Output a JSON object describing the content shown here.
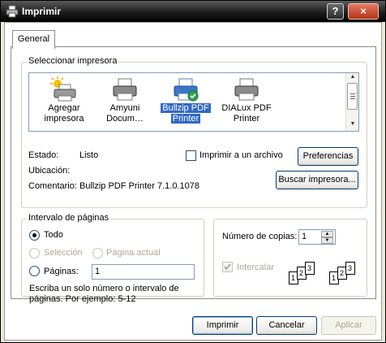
{
  "window": {
    "title": "Imprimir"
  },
  "tabs": [
    {
      "label": "General"
    }
  ],
  "printer_group": {
    "legend": "Seleccionar impresora",
    "printers": [
      {
        "line1": "Agregar",
        "line2": "impresora",
        "icon": "add-printer-icon"
      },
      {
        "line1": "Amyuni",
        "line2": "Docum…",
        "icon": "printer-icon"
      },
      {
        "line1": "Bullzip PDF",
        "line2": "Printer",
        "icon": "default-printer-icon",
        "selected": true
      },
      {
        "line1": "DIALux PDF",
        "line2": "Printer",
        "icon": "printer-icon"
      }
    ],
    "estado_label": "Estado:",
    "estado_value": "Listo",
    "ubicacion_label": "Ubicación:",
    "ubicacion_value": "",
    "comentario_label": "Comentario:",
    "comentario_value": "Bullzip PDF Printer 7.1.0.1078",
    "print_to_file_label": "Imprimir a un archivo",
    "print_to_file_checked": false,
    "preferences_button": "Preferencias",
    "find_printer_button": "Buscar impresora..."
  },
  "range_group": {
    "legend": "Intervalo de páginas",
    "all_label": "Todo",
    "selection_label": "Selección",
    "current_page_label": "Página actual",
    "pages_label": "Páginas:",
    "pages_value": "1",
    "help_text_1": "Escriba un solo número o intervalo de",
    "help_text_2": "páginas. Por ejemplo: 5-12"
  },
  "copies_group": {
    "copies_label": "Número de copias:",
    "copies_value": "1",
    "collate_label": "Intercalar",
    "collate_checked": true,
    "collate_pages": [
      "1",
      "2",
      "3"
    ]
  },
  "buttons": {
    "print": "Imprimir",
    "cancel": "Cancelar",
    "apply": "Aplicar"
  },
  "titlebar": {
    "help": "?",
    "close": "×"
  }
}
